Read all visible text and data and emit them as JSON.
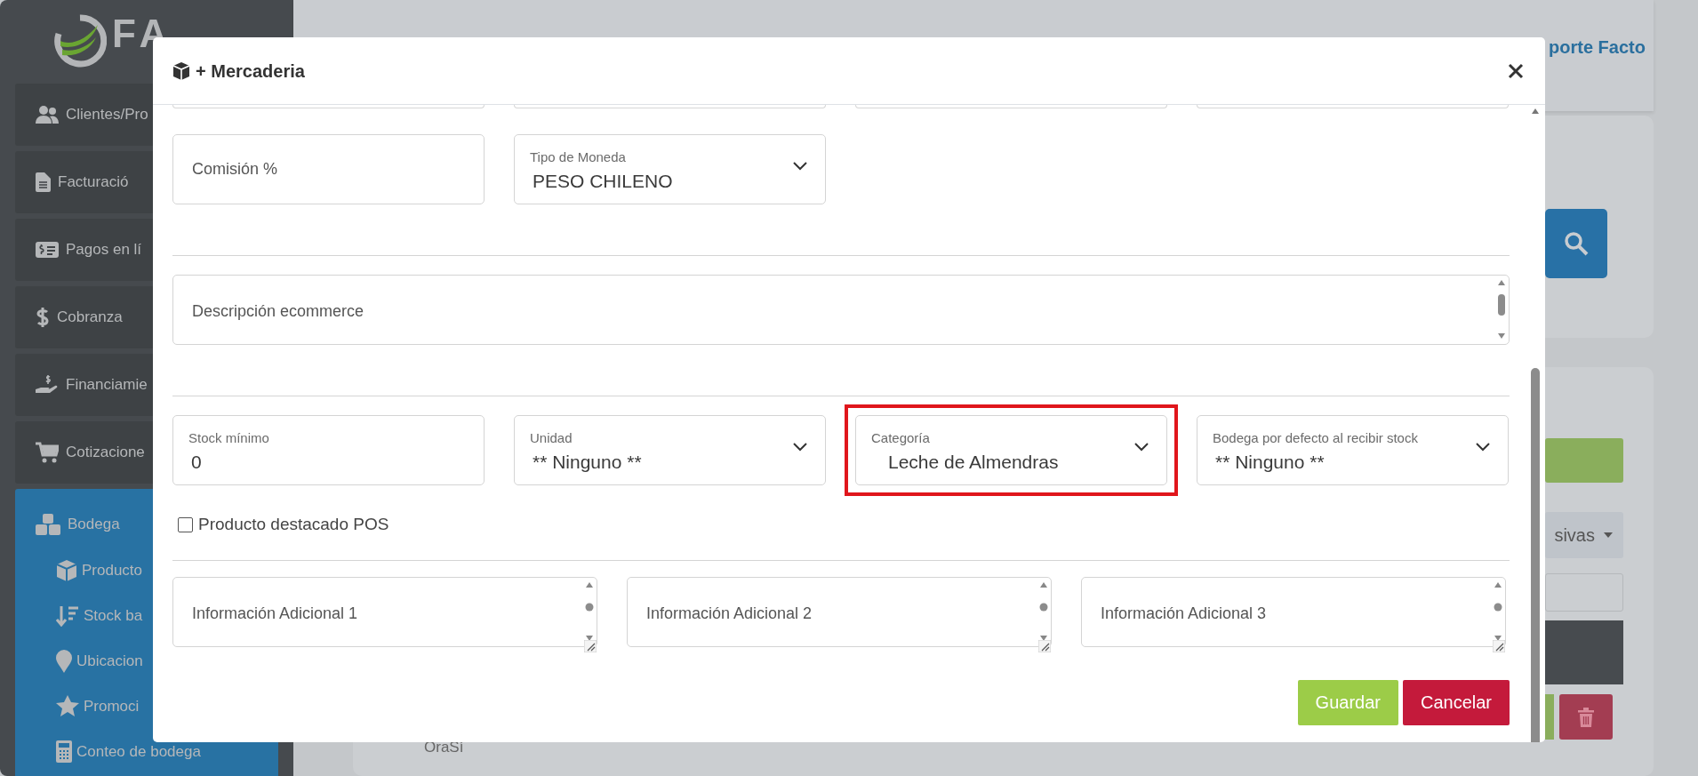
{
  "logo": {
    "text": "FA"
  },
  "sidebar": {
    "items": [
      {
        "label": "Clientes/Pro",
        "selected": false
      },
      {
        "label": "Facturació",
        "selected": false
      },
      {
        "label": "Pagos en lí",
        "selected": false
      },
      {
        "label": "Cobranza",
        "selected": false
      },
      {
        "label": "Financiamie",
        "selected": false
      },
      {
        "label": "Cotizacione",
        "selected": false
      },
      {
        "label": "Bodega",
        "selected": true,
        "children": [
          {
            "label": "Producto"
          },
          {
            "label": "Stock ba"
          },
          {
            "label": "Ubicacion"
          },
          {
            "label": "Promoci"
          },
          {
            "label": "Conteo de bodega"
          }
        ]
      }
    ]
  },
  "header": {
    "user": "porte Facto"
  },
  "background": {
    "dropdown": "sivas",
    "text": "OraSí"
  },
  "modal": {
    "title": "+ Mercaderia",
    "rows": [
      {
        "fields": [
          {
            "kind": "text",
            "placeholder": "Comisión %",
            "highlighted": false
          },
          {
            "kind": "select",
            "label": "Tipo de Moneda",
            "value": "PESO CHILENO",
            "highlighted": false
          }
        ]
      },
      {
        "fields": [
          {
            "kind": "textarea",
            "placeholder": "Descripción ecommerce",
            "highlighted": false
          }
        ]
      },
      {
        "fields": [
          {
            "kind": "text",
            "label": "Stock mínimo",
            "value": "0",
            "highlighted": false
          },
          {
            "kind": "select",
            "label": "Unidad",
            "value": "** Ninguno **",
            "highlighted": false
          },
          {
            "kind": "select",
            "label": "Categoría",
            "value": "Leche de Almendras",
            "highlighted": true
          },
          {
            "kind": "select",
            "label": "Bodega por defecto al recibir stock",
            "value": "** Ninguno **",
            "highlighted": false
          }
        ]
      }
    ],
    "checkbox": {
      "label": "Producto destacado POS",
      "checked": false
    },
    "notes": [
      {
        "placeholder": "Información Adicional 1"
      },
      {
        "placeholder": "Información Adicional 2"
      },
      {
        "placeholder": "Información Adicional 3"
      }
    ],
    "buttons": [
      {
        "kind": "save",
        "label": "Guardar"
      },
      {
        "kind": "cancel",
        "label": "Cancelar"
      }
    ]
  }
}
